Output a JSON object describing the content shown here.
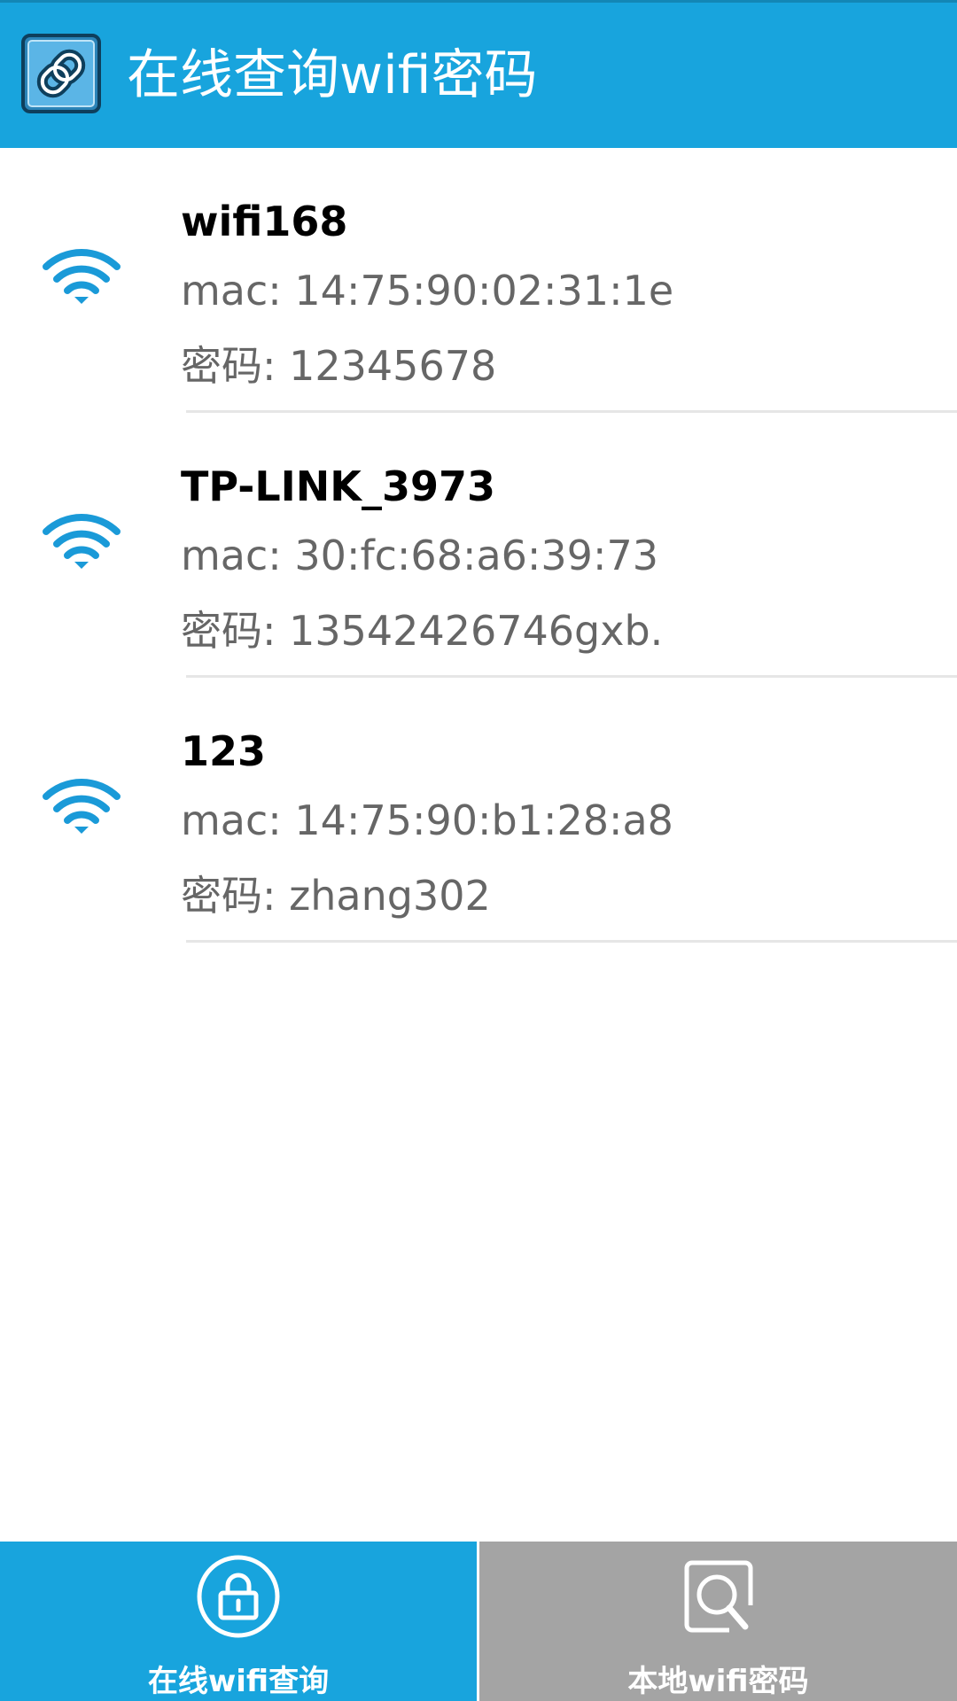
{
  "header": {
    "title": "在线查询wifi密码",
    "icon": "app-link-icon",
    "background": "#18a4dd"
  },
  "wifi_list": [
    {
      "ssid": "wifi168",
      "mac": "mac: 14:75:90:02:31:1e",
      "password": "密码: 12345678",
      "icon": "wifi-signal-icon"
    },
    {
      "ssid": "TP-LINK_3973",
      "mac": "mac: 30:fc:68:a6:39:73",
      "password": "密码: 13542426746gxb.",
      "icon": "wifi-signal-icon"
    },
    {
      "ssid": "123",
      "mac": "mac: 14:75:90:b1:28:a8",
      "password": "密码: zhang302",
      "icon": "wifi-signal-icon"
    }
  ],
  "tabs": [
    {
      "label": "在线wifi查询",
      "icon": "lock-icon",
      "active": true,
      "color": "#18a4dd"
    },
    {
      "label": "本地wifi密码",
      "icon": "search-icon",
      "active": false,
      "color": "#a4a4a4"
    }
  ],
  "colors": {
    "accent": "#18a4dd",
    "wifi_icon": "#1a9ad8",
    "secondary_text": "#666666",
    "inactive_tab": "#a4a4a4"
  }
}
